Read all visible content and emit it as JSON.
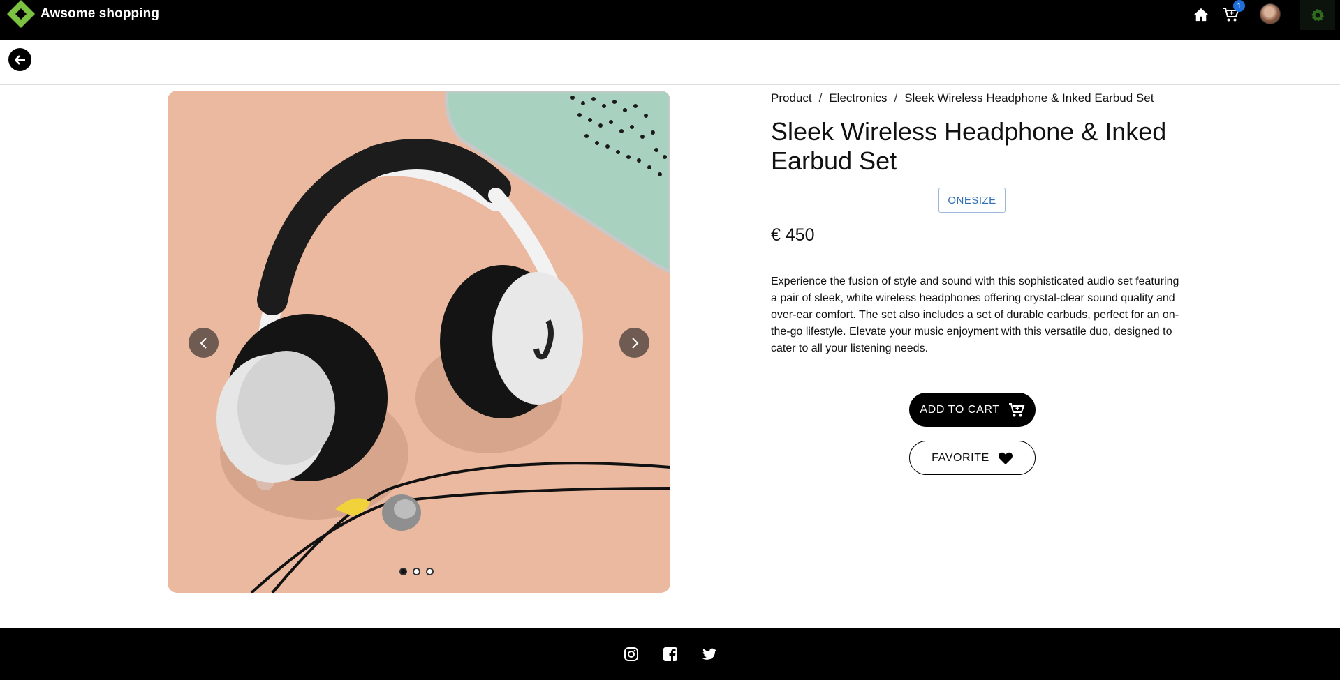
{
  "header": {
    "brand": "Awsome shopping",
    "cart_count": "1",
    "icons": [
      "logo-icon",
      "home-icon",
      "cart-icon",
      "avatar",
      "settings-icon"
    ]
  },
  "breadcrumb": {
    "items": [
      "Product",
      "Electronics",
      "Sleek Wireless Headphone & Inked Earbud Set"
    ],
    "separator": "/"
  },
  "product": {
    "title": "Sleek Wireless Headphone & Inked Earbud Set",
    "size": "ONESIZE",
    "price": "€ 450",
    "description": "Experience the fusion of style and sound with this sophisticated audio set featuring a pair of sleek, white wireless headphones offering crystal-clear sound quality and over-ear comfort. The set also includes a set of durable earbuds, perfect for an on-the-go lifestyle. Elevate your music enjoyment with this versatile duo, designed to cater to all your listening needs.",
    "image_count": 3,
    "active_image": 1
  },
  "actions": {
    "add_to_cart": "ADD TO CART",
    "favorite": "FAVORITE"
  },
  "footer": {
    "social": [
      "instagram-icon",
      "facebook-icon",
      "twitter-icon"
    ]
  },
  "colors": {
    "topbar": "#000000",
    "badge": "#1e6fd9",
    "size_border": "#9db6d9",
    "size_text": "#2f6eb4",
    "logo_green": "#7cc242"
  }
}
